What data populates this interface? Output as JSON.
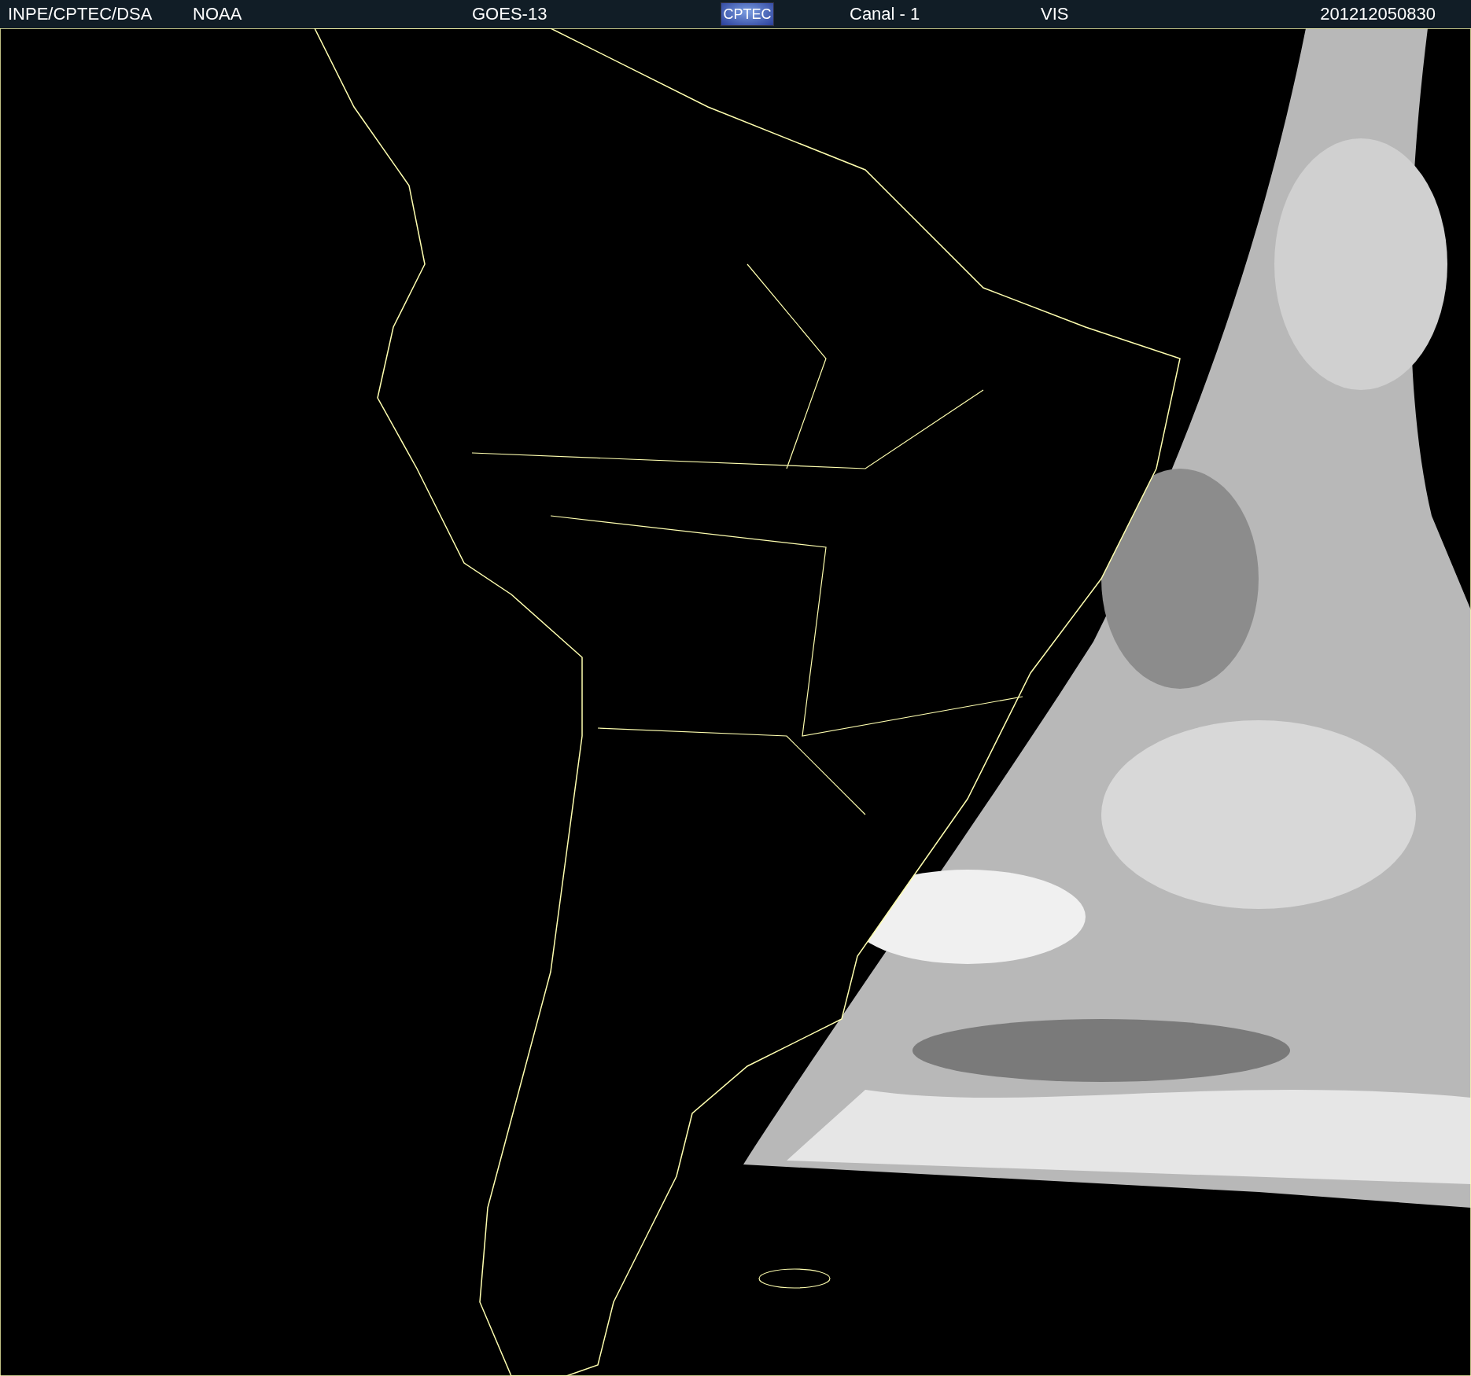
{
  "header": {
    "agency": "INPE/CPTEC/DSA",
    "source": "NOAA",
    "satellite": "GOES-13",
    "logo": "CPTEC",
    "channel": "Canal - 1",
    "band": "VIS",
    "timestamp": "201212050830"
  }
}
